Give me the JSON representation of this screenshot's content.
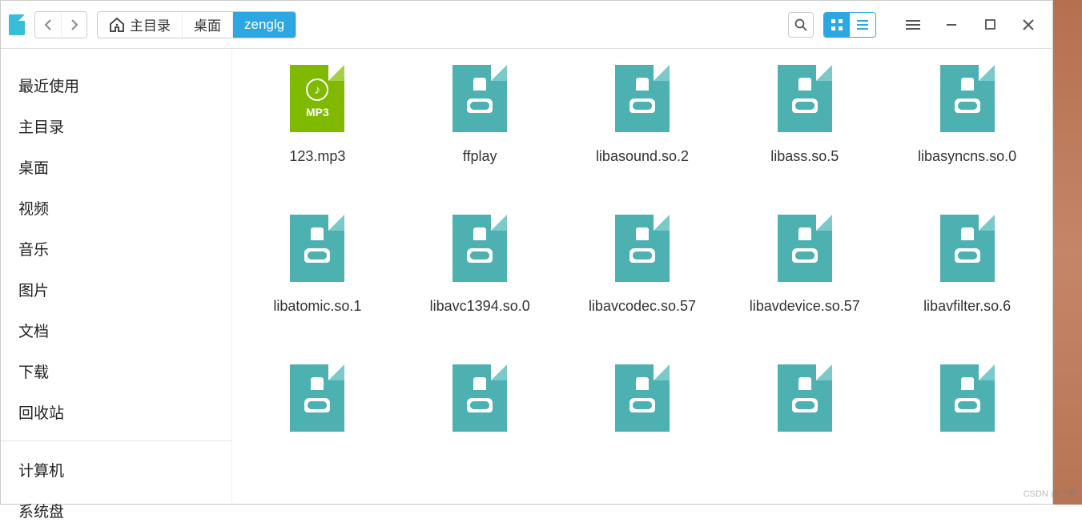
{
  "breadcrumb": {
    "home_label": "主目录",
    "desktop_label": "桌面",
    "current_label": "zenglg"
  },
  "sidebar": {
    "items": [
      {
        "label": "最近使用"
      },
      {
        "label": "主目录"
      },
      {
        "label": "桌面"
      },
      {
        "label": "视频"
      },
      {
        "label": "音乐"
      },
      {
        "label": "图片"
      },
      {
        "label": "文档"
      },
      {
        "label": "下载"
      },
      {
        "label": "回收站"
      }
    ],
    "computer_label": "计算机",
    "sysdisk_label": "系统盘"
  },
  "files": [
    {
      "name": "123.mp3",
      "type": "mp3",
      "mp3_label": "MP3"
    },
    {
      "name": "ffplay",
      "type": "so"
    },
    {
      "name": "libasound.so.2",
      "type": "so"
    },
    {
      "name": "libass.so.5",
      "type": "so"
    },
    {
      "name": "libasyncns.so.0",
      "type": "so"
    },
    {
      "name": "libatomic.so.1",
      "type": "so"
    },
    {
      "name": "libavc1394.so.0",
      "type": "so"
    },
    {
      "name": "libavcodec.so.57",
      "type": "so"
    },
    {
      "name": "libavdevice.so.57",
      "type": "so"
    },
    {
      "name": "libavfilter.so.6",
      "type": "so"
    },
    {
      "name": "",
      "type": "so"
    },
    {
      "name": "",
      "type": "so"
    },
    {
      "name": "",
      "type": "so"
    },
    {
      "name": "",
      "type": "so"
    },
    {
      "name": "",
      "type": "so"
    }
  ],
  "watermark": "CSDN @三希"
}
